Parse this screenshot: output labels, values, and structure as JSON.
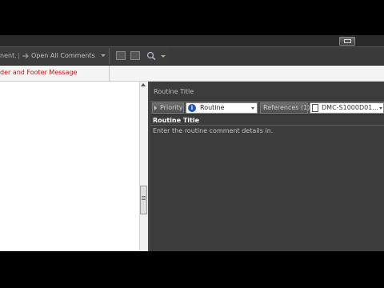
{
  "toolbar": {
    "comment_label": "nent.",
    "open_all_label": "Open All Comments",
    "icons": [
      "arrow-icon",
      "grid-icon",
      "zoom-icon",
      "find-icon"
    ]
  },
  "header_footer": {
    "label": "der and Footer Message",
    "color": "#c0171b"
  },
  "comment_pane": {
    "title": "Routine Title",
    "priority_label": "Priority",
    "priority_value": "Routine",
    "references_label": "References (1)",
    "reference_value": "DMC-S1000D01...",
    "comment_title": "Routine Title",
    "comment_body": "Enter the routine comment details in."
  },
  "colors": {
    "background": "#000000",
    "toolbar": "#3d3d3d",
    "pane": "#3c3c3c",
    "accent_red": "#c0171b",
    "info_blue": "#2456b8"
  }
}
